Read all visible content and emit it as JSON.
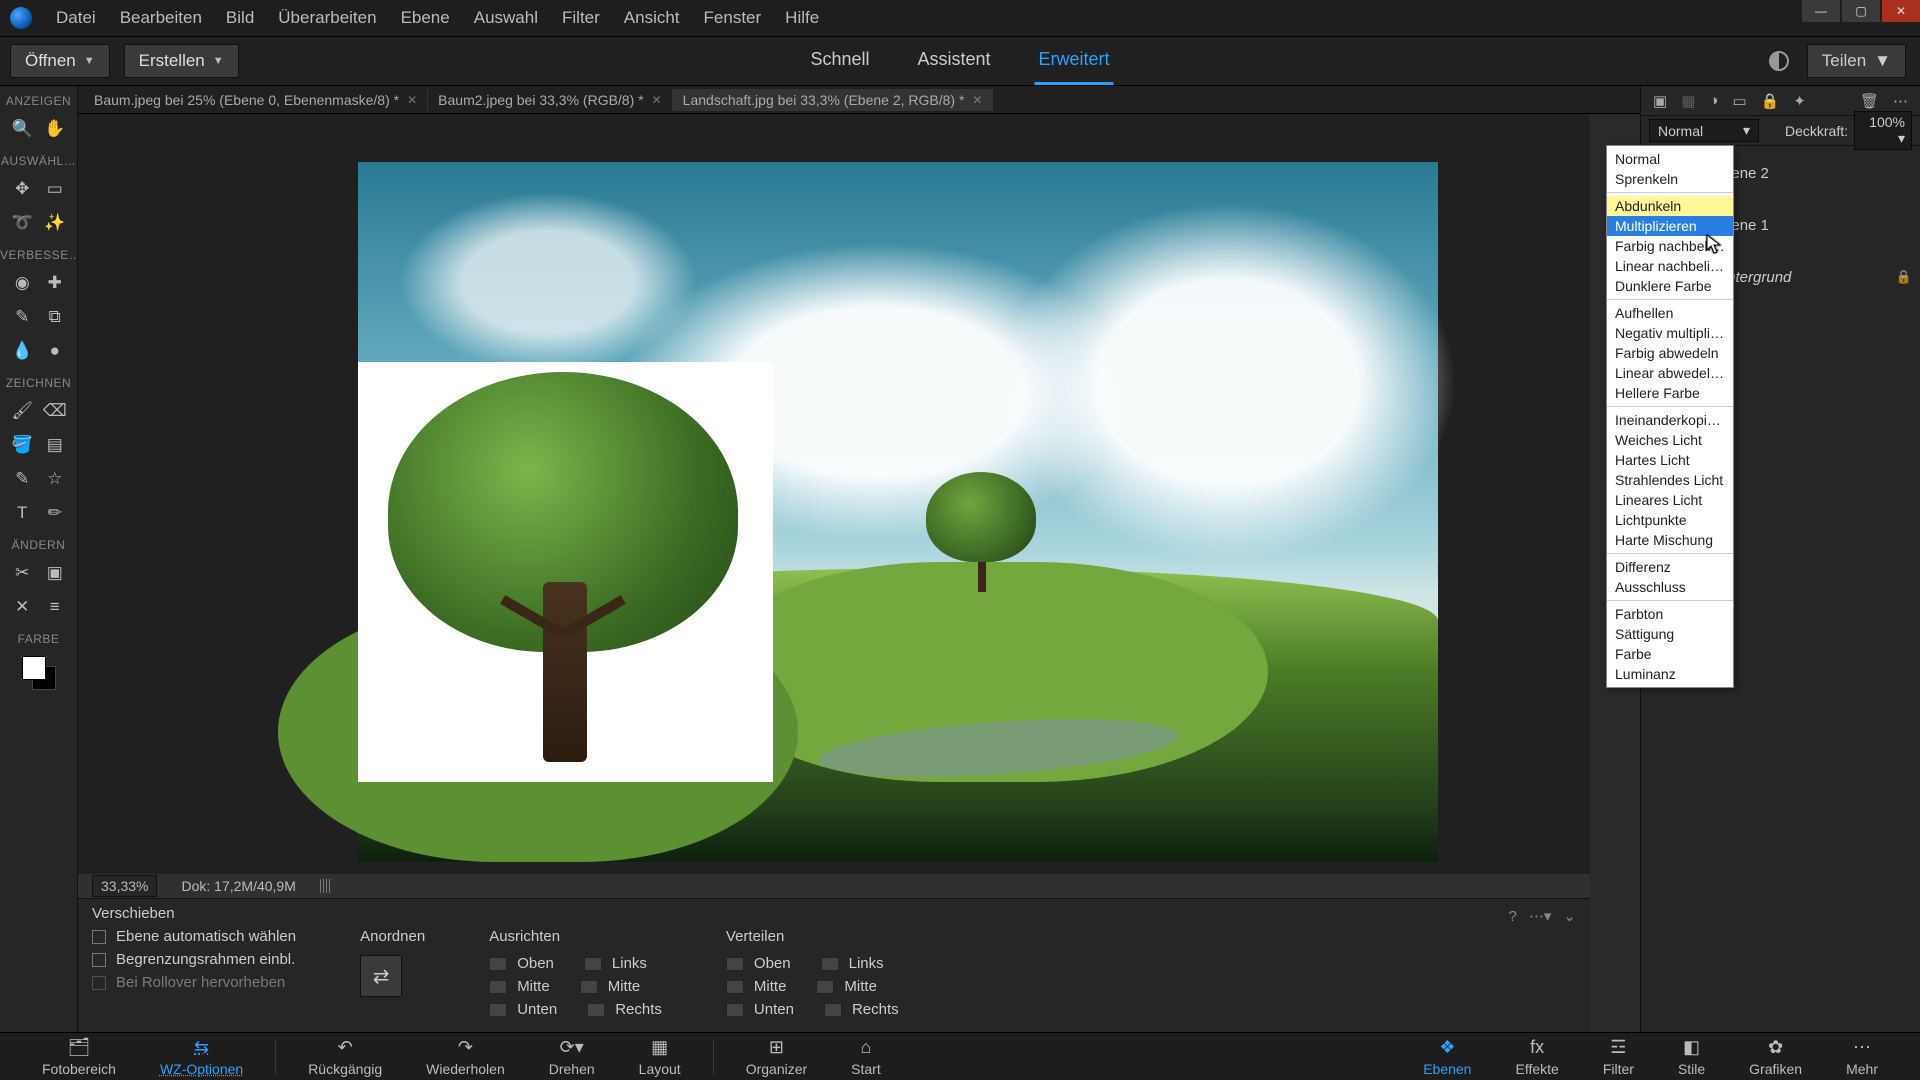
{
  "menu": {
    "items": [
      "Datei",
      "Bearbeiten",
      "Bild",
      "Überarbeiten",
      "Ebene",
      "Auswahl",
      "Filter",
      "Ansicht",
      "Fenster",
      "Hilfe"
    ]
  },
  "topbar": {
    "open": "Öffnen",
    "create": "Erstellen",
    "modes": {
      "quick": "Schnell",
      "guided": "Assistent",
      "expert": "Erweitert"
    },
    "share": "Teilen"
  },
  "tabs": [
    {
      "label": "Baum.jpeg bei 25% (Ebene 0, Ebenenmaske/8) *"
    },
    {
      "label": "Baum2.jpeg bei 33,3% (RGB/8) *"
    },
    {
      "label": "Landschaft.jpg bei 33,3% (Ebene 2, RGB/8) *",
      "active": true
    }
  ],
  "left": {
    "view": "ANZEIGEN",
    "select": "AUSWÄHL…",
    "enhance": "VERBESSE…",
    "draw": "ZEICHNEN",
    "modify": "ÄNDERN",
    "color": "FARBE"
  },
  "status": {
    "zoom": "33,33%",
    "doc": "Dok: 17,2M/40,9M"
  },
  "options": {
    "title": "Verschieben",
    "autoSelect": "Ebene automatisch wählen",
    "bounds": "Begrenzungsrahmen einbl.",
    "rollover": "Bei Rollover hervorheben",
    "arrange": "Anordnen",
    "align": "Ausrichten",
    "distribute": "Verteilen",
    "top": "Oben",
    "middle": "Mitte",
    "bottom": "Unten",
    "left": "Links",
    "center": "Mitte",
    "right": "Rechts"
  },
  "bottom": {
    "photobin": "Fotobereich",
    "toolopts": "WZ-Optionen",
    "undo": "Rückgängig",
    "redo": "Wiederholen",
    "rotate": "Drehen",
    "layout": "Layout",
    "organizer": "Organizer",
    "home": "Start",
    "layers": "Ebenen",
    "effects": "Effekte",
    "filters": "Filter",
    "styles": "Stile",
    "graphics": "Grafiken",
    "more": "Mehr"
  },
  "rp": {
    "blend_selected": "Normal",
    "opacity_label": "Deckkraft:",
    "opacity_value": "100%",
    "layers": {
      "l2": "Ebene 2",
      "l1": "Ebene 1",
      "bg": "Hintergrund"
    }
  },
  "blend": {
    "g1": [
      "Normal",
      "Sprenkeln"
    ],
    "g2": [
      "Abdunkeln",
      "Multiplizieren",
      "Farbig nachbelicht…",
      "Linear nachbelicht…",
      "Dunklere Farbe"
    ],
    "g3": [
      "Aufhellen",
      "Negativ multiplizie…",
      "Farbig abwedeln",
      "Linear abwedeln (…",
      "Hellere Farbe"
    ],
    "g4": [
      "Ineinanderkopieren",
      "Weiches Licht",
      "Hartes Licht",
      "Strahlendes Licht",
      "Lineares Licht",
      "Lichtpunkte",
      "Harte Mischung"
    ],
    "g5": [
      "Differenz",
      "Ausschluss"
    ],
    "g6": [
      "Farbton",
      "Sättigung",
      "Farbe",
      "Luminanz"
    ]
  }
}
